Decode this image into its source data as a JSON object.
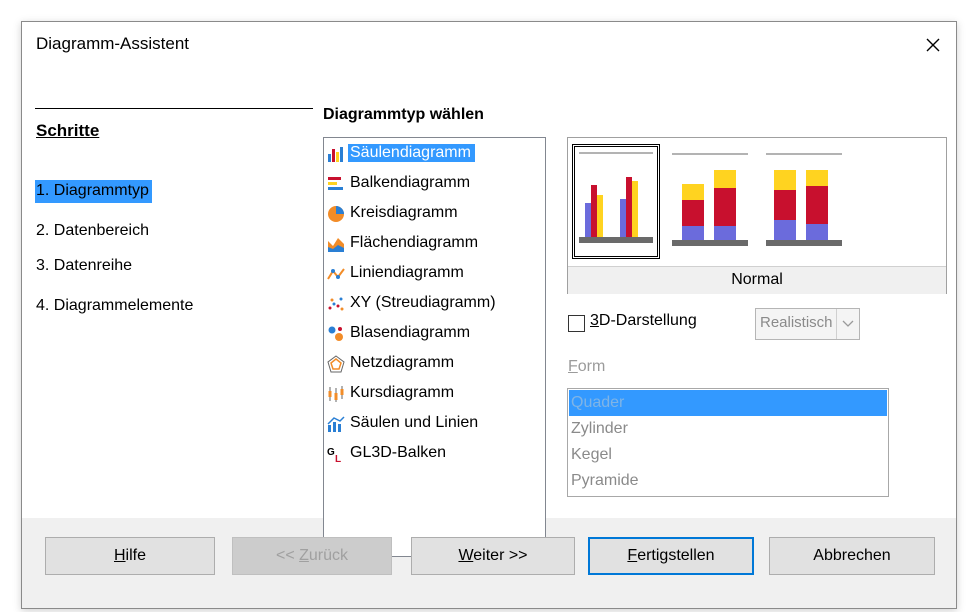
{
  "window": {
    "title": "Diagramm-Assistent"
  },
  "steps": {
    "heading": "Schritte",
    "items": [
      {
        "label": "1. Diagrammtyp",
        "active": true
      },
      {
        "label": "2. Datenbereich",
        "active": false
      },
      {
        "label": "3. Datenreihe",
        "active": false
      },
      {
        "label": "4. Diagrammelemente",
        "active": false
      }
    ]
  },
  "chart_type": {
    "heading": "Diagrammtyp wählen",
    "types": [
      {
        "label": "Säulendiagramm",
        "icon": "column-chart-icon",
        "selected": true
      },
      {
        "label": "Balkendiagramm",
        "icon": "bar-chart-icon",
        "selected": false
      },
      {
        "label": "Kreisdiagramm",
        "icon": "pie-chart-icon",
        "selected": false
      },
      {
        "label": "Flächendiagramm",
        "icon": "area-chart-icon",
        "selected": false
      },
      {
        "label": "Liniendiagramm",
        "icon": "line-chart-icon",
        "selected": false
      },
      {
        "label": "XY (Streudiagramm)",
        "icon": "scatter-chart-icon",
        "selected": false
      },
      {
        "label": "Blasendiagramm",
        "icon": "bubble-chart-icon",
        "selected": false
      },
      {
        "label": "Netzdiagramm",
        "icon": "net-chart-icon",
        "selected": false
      },
      {
        "label": "Kursdiagramm",
        "icon": "stock-chart-icon",
        "selected": false
      },
      {
        "label": "Säulen und Linien",
        "icon": "column-line-chart-icon",
        "selected": false
      },
      {
        "label": "GL3D-Balken",
        "icon": "gl3d-bar-icon",
        "selected": false
      }
    ]
  },
  "variant": {
    "name": "Normal",
    "options": [
      "normal-variant",
      "stacked-variant",
      "percent-stacked-variant"
    ]
  },
  "three_d": {
    "label_prefix": "3",
    "label_rest": "D-Darstellung",
    "checked": false,
    "dropdown_value": "Realistisch"
  },
  "form": {
    "label_prefix": "F",
    "label_rest": "orm",
    "items": [
      {
        "label": "Quader",
        "selected": true
      },
      {
        "label": "Zylinder",
        "selected": false
      },
      {
        "label": "Kegel",
        "selected": false
      },
      {
        "label": "Pyramide",
        "selected": false
      }
    ]
  },
  "buttons": {
    "help": {
      "prefix": "H",
      "rest": "ilfe"
    },
    "back": {
      "pre": "<< ",
      "u": "Z",
      "rest": "urück"
    },
    "next": {
      "u": "W",
      "rest": "eiter >>"
    },
    "finish": {
      "u": "F",
      "rest": "ertigstellen"
    },
    "cancel": {
      "label": "Abbrechen"
    }
  },
  "colors": {
    "selection": "#3399ff",
    "bar_blue": "#6b6bdc",
    "bar_red": "#c8102e",
    "bar_yellow": "#ffd320"
  }
}
